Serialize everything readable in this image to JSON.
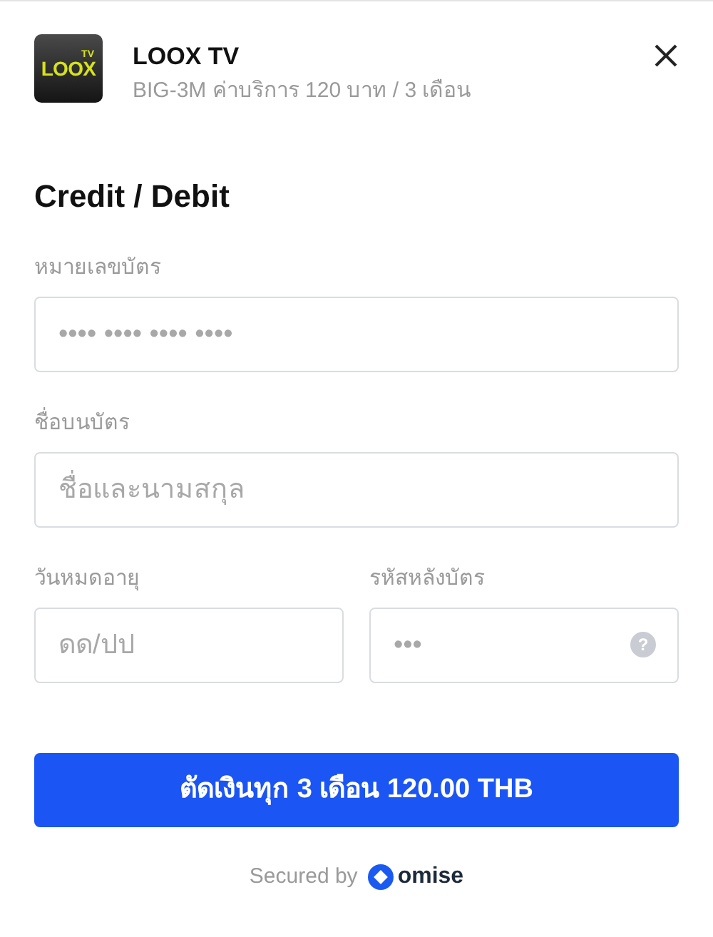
{
  "merchant": {
    "logo_text": "LOOX",
    "logo_badge": "TV",
    "name": "LOOX TV",
    "description": "BIG-3M ค่าบริการ 120 บาท / 3 เดือน"
  },
  "heading": "Credit / Debit",
  "fields": [
    {
      "label": "หมายเลขบัตร",
      "placeholder": "•••• •••• •••• ••••"
    },
    {
      "label": "ชื่อบนบัตร",
      "placeholder": "ชื่อและนามสกุล"
    }
  ],
  "half_fields": [
    {
      "label": "วันหมดอายุ",
      "placeholder": "ดด/ปป"
    },
    {
      "label": "รหัสหลังบัตร",
      "placeholder": "•••",
      "help": "?"
    }
  ],
  "pay_button": "ตัดเงินทุก 3 เดือน 120.00 THB",
  "footer": {
    "text": "Secured by",
    "brand": "omise"
  }
}
